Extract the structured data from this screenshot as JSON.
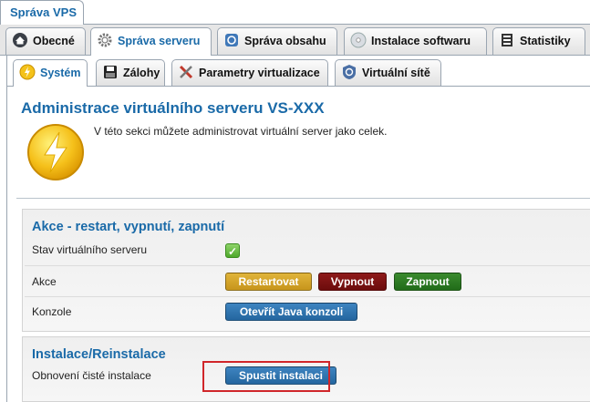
{
  "app_tab": {
    "label": "Správa VPS"
  },
  "main_tabs": [
    {
      "label": "Obecné",
      "icon": "home-icon",
      "active": false
    },
    {
      "label": "Správa serveru",
      "icon": "gear-icon",
      "active": true
    },
    {
      "label": "Správa obsahu",
      "icon": "content-icon",
      "active": false
    },
    {
      "label": "Instalace softwaru",
      "icon": "cd-icon",
      "active": false
    },
    {
      "label": "Statistiky",
      "icon": "stats-icon",
      "active": false
    }
  ],
  "sub_tabs": [
    {
      "label": "Systém",
      "icon": "bolt-icon",
      "active": true
    },
    {
      "label": "Zálohy",
      "icon": "floppy-icon",
      "active": false
    },
    {
      "label": "Parametry virtualizace",
      "icon": "tools-icon",
      "active": false
    },
    {
      "label": "Virtuální sítě",
      "icon": "network-icon",
      "active": false
    }
  ],
  "page": {
    "title": "Administrace virtuálního serveru VS-XXX",
    "intro": "V této sekci můžete administrovat virtuální server jako celek."
  },
  "actions_section": {
    "title": "Akce - restart, vypnutí, zapnutí",
    "status_label": "Stav virtuálního serveru",
    "status_icon": "check-icon",
    "actions_label": "Akce",
    "restart_label": "Restartovat",
    "shutdown_label": "Vypnout",
    "start_label": "Zapnout",
    "console_label": "Konzole",
    "console_button": "Otevřít Java konzoli"
  },
  "install_section": {
    "title": "Instalace/Reinstalace",
    "reinstall_label": "Obnovení čisté instalace",
    "reinstall_button": "Spustit instalaci"
  },
  "colors": {
    "accent": "#1a6aa8",
    "restart": "#c7951c",
    "shutdown": "#6c0c0c",
    "start": "#216c19",
    "primary": "#24669f",
    "highlight": "#d0262a"
  }
}
